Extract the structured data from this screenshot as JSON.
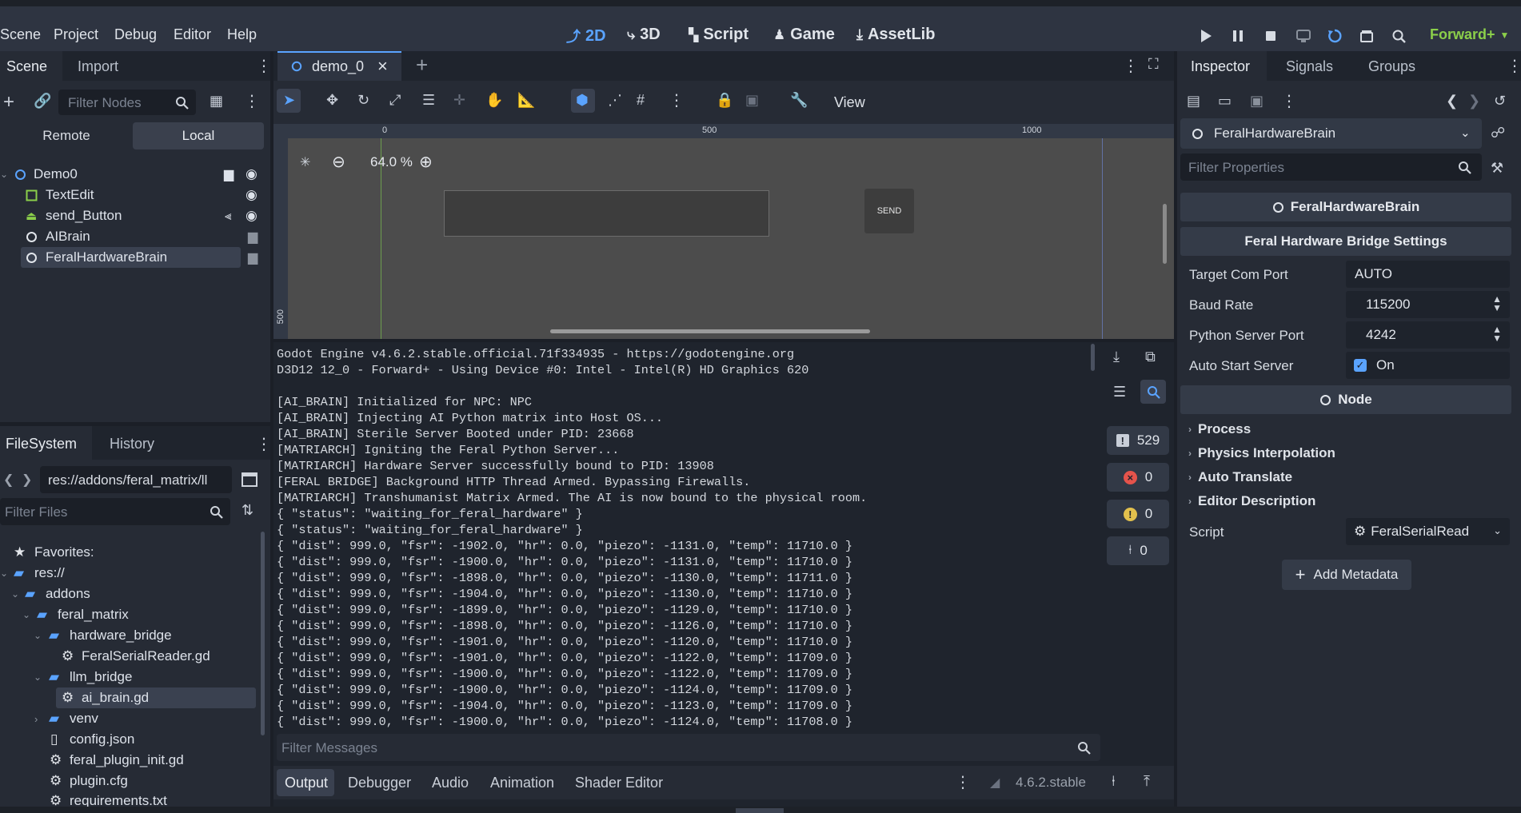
{
  "menu": [
    "Scene",
    "Project",
    "Debug",
    "Editor",
    "Help"
  ],
  "workspaces": [
    {
      "label": "2D",
      "icon": "2d-icon"
    },
    {
      "label": "3D",
      "icon": "3d-icon"
    },
    {
      "label": "Script",
      "icon": "script-icon"
    },
    {
      "label": "Game",
      "icon": "game-icon"
    },
    {
      "label": "AssetLib",
      "icon": "assetlib-icon"
    }
  ],
  "renderer": "Forward+",
  "scene_panel": {
    "tabs": [
      "Scene",
      "Import"
    ],
    "filter_placeholder": "Filter Nodes",
    "remote": "Remote",
    "local": "Local",
    "nodes": [
      "Demo0",
      "TextEdit",
      "send_Button",
      "AIBrain",
      "FeralHardwareBrain"
    ]
  },
  "filesystem": {
    "tabs": [
      "FileSystem",
      "History"
    ],
    "path": "res://addons/feral_matrix/ll",
    "filter_placeholder": "Filter Files",
    "items": [
      "Favorites:",
      "res://",
      "addons",
      "feral_matrix",
      "hardware_bridge",
      "FeralSerialReader.gd",
      "llm_bridge",
      "ai_brain.gd",
      "venv",
      "config.json",
      "feral_plugin_init.gd",
      "plugin.cfg",
      "requirements.txt"
    ]
  },
  "editor": {
    "tab": "demo_0",
    "view_label": "View",
    "zoom": "64.0 %",
    "ruler": [
      "0",
      "500",
      "1000"
    ],
    "ruler_v": "500",
    "send_label": "SEND"
  },
  "console": {
    "lines": [
      "Godot Engine v4.6.2.stable.official.71f334935 - https://godotengine.org",
      "D3D12 12_0 - Forward+ - Using Device #0: Intel - Intel(R) HD Graphics 620",
      "",
      "[AI_BRAIN] Initialized for NPC: NPC",
      "[AI_BRAIN] Injecting AI Python matrix into Host OS...",
      "[AI_BRAIN] Sterile Server Booted under PID: 23668",
      "[MATRIARCH] Igniting the Feral Python Server...",
      "[MATRIARCH] Hardware Server successfully bound to PID: 13908",
      "[FERAL BRIDGE] Background HTTP Thread Armed. Bypassing Firewalls.",
      "[MATRIARCH] Transhumanist Matrix Armed. The AI is now bound to the physical room.",
      "{ \"status\": \"waiting_for_feral_hardware\" }",
      "{ \"status\": \"waiting_for_feral_hardware\" }",
      "{ \"dist\": 999.0, \"fsr\": -1902.0, \"hr\": 0.0, \"piezo\": -1131.0, \"temp\": 11710.0 }",
      "{ \"dist\": 999.0, \"fsr\": -1900.0, \"hr\": 0.0, \"piezo\": -1131.0, \"temp\": 11710.0 }",
      "{ \"dist\": 999.0, \"fsr\": -1898.0, \"hr\": 0.0, \"piezo\": -1130.0, \"temp\": 11711.0 }",
      "{ \"dist\": 999.0, \"fsr\": -1904.0, \"hr\": 0.0, \"piezo\": -1130.0, \"temp\": 11710.0 }",
      "{ \"dist\": 999.0, \"fsr\": -1899.0, \"hr\": 0.0, \"piezo\": -1129.0, \"temp\": 11710.0 }",
      "{ \"dist\": 999.0, \"fsr\": -1898.0, \"hr\": 0.0, \"piezo\": -1126.0, \"temp\": 11710.0 }",
      "{ \"dist\": 999.0, \"fsr\": -1901.0, \"hr\": 0.0, \"piezo\": -1120.0, \"temp\": 11710.0 }",
      "{ \"dist\": 999.0, \"fsr\": -1901.0, \"hr\": 0.0, \"piezo\": -1122.0, \"temp\": 11709.0 }",
      "{ \"dist\": 999.0, \"fsr\": -1900.0, \"hr\": 0.0, \"piezo\": -1122.0, \"temp\": 11709.0 }",
      "{ \"dist\": 999.0, \"fsr\": -1900.0, \"hr\": 0.0, \"piezo\": -1124.0, \"temp\": 11709.0 }",
      "{ \"dist\": 999.0, \"fsr\": -1904.0, \"hr\": 0.0, \"piezo\": -1123.0, \"temp\": 11709.0 }",
      "{ \"dist\": 999.0, \"fsr\": -1900.0, \"hr\": 0.0, \"piezo\": -1124.0, \"temp\": 11708.0 }"
    ],
    "counts": {
      "messages": "529",
      "errors": "0",
      "warnings": "0",
      "editor": "0"
    },
    "filter_placeholder": "Filter Messages",
    "bottom_tabs": [
      "Output",
      "Debugger",
      "Audio",
      "Animation",
      "Shader Editor"
    ],
    "version": "4.6.2.stable"
  },
  "inspector": {
    "tabs": [
      "Inspector",
      "Signals",
      "Groups"
    ],
    "object": "FeralHardwareBrain",
    "filter_placeholder": "Filter Properties",
    "header": "FeralHardwareBrain",
    "group": "Feral Hardware Bridge Settings",
    "props": {
      "target_com_port": {
        "label": "Target Com Port",
        "value": "AUTO"
      },
      "baud_rate": {
        "label": "Baud Rate",
        "value": "115200"
      },
      "python_server_port": {
        "label": "Python Server Port",
        "value": "4242"
      },
      "auto_start_server": {
        "label": "Auto Start Server",
        "value": "On"
      }
    },
    "node_section": "Node",
    "categories": [
      "Process",
      "Physics Interpolation",
      "Auto Translate",
      "Editor Description"
    ],
    "script_label": "Script",
    "script_value": "FeralSerialRead",
    "add_metadata": "Add Metadata"
  },
  "colors": {
    "accent": "#5aa3ff",
    "renderer": "#8bcf4a",
    "bg": "#2e3441",
    "panel": "#262b35"
  }
}
